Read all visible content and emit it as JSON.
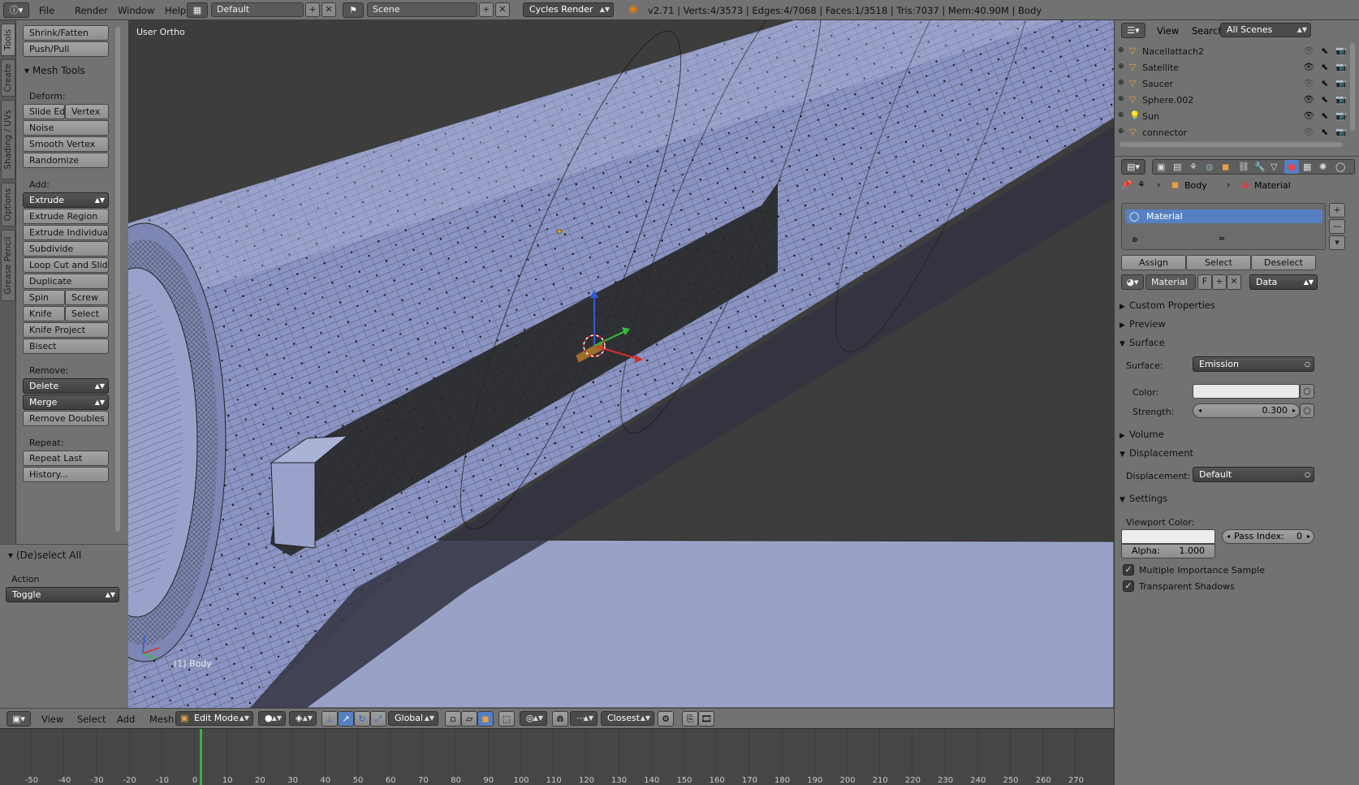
{
  "topbar": {
    "menus": [
      "File",
      "Render",
      "Window",
      "Help"
    ],
    "layout": "Default",
    "scene": "Scene",
    "engine": "Cycles Render",
    "stats": "v2.71 | Verts:4/3573 | Edges:4/7068 | Faces:1/3518 | Tris:7037 | Mem:40.90M | Body"
  },
  "left_tabs": [
    "Tools",
    "Create",
    "Shading / UVs",
    "Options",
    "Grease Pencil"
  ],
  "tools": {
    "top_buttons": [
      "Shrink/Fatten",
      "Push/Pull"
    ],
    "panel_title": "Mesh Tools",
    "deform_label": "Deform:",
    "deform": {
      "slide_edge": "Slide Ed",
      "vertex": "Vertex",
      "noise": "Noise",
      "smooth": "Smooth Vertex",
      "randomize": "Randomize"
    },
    "add_label": "Add:",
    "add": {
      "extrude": "Extrude",
      "extrude_region": "Extrude Region",
      "extrude_individual": "Extrude Individual",
      "subdivide": "Subdivide",
      "loop_cut": "Loop Cut and Slide",
      "duplicate": "Duplicate",
      "spin": "Spin",
      "screw": "Screw",
      "knife": "Knife",
      "select": "Select",
      "knife_project": "Knife Project",
      "bisect": "Bisect"
    },
    "remove_label": "Remove:",
    "remove": {
      "delete": "Delete",
      "merge": "Merge",
      "remove_doubles": "Remove Doubles"
    },
    "repeat_label": "Repeat:",
    "repeat": {
      "repeat_last": "Repeat Last",
      "history": "History..."
    }
  },
  "operator": {
    "title": "(De)select All",
    "action_label": "Action",
    "action_value": "Toggle"
  },
  "viewport": {
    "view_name": "User Ortho",
    "object_label": "(1) Body"
  },
  "view3d_header": {
    "menus": [
      "View",
      "Select",
      "Add",
      "Mesh"
    ],
    "mode": "Edit Mode",
    "orientation": "Global",
    "snap": "Closest"
  },
  "timeline": {
    "ticks": [
      "-50",
      "-40",
      "-30",
      "-20",
      "-10",
      "0",
      "10",
      "20",
      "30",
      "40",
      "50",
      "60",
      "70",
      "80",
      "90",
      "100",
      "110",
      "120",
      "130",
      "140",
      "150",
      "160",
      "170",
      "180",
      "190",
      "200",
      "210",
      "220",
      "230",
      "240",
      "250",
      "260",
      "270"
    ]
  },
  "outliner": {
    "menus": [
      "View",
      "Search"
    ],
    "scene_filter": "All Scenes",
    "items": [
      {
        "name": "Nacellattach2",
        "type": "mesh",
        "visible": false
      },
      {
        "name": "Satellite",
        "type": "mesh",
        "visible": true
      },
      {
        "name": "Saucer",
        "type": "mesh",
        "visible": false
      },
      {
        "name": "Sphere.002",
        "type": "mesh",
        "visible": true
      },
      {
        "name": "Sun",
        "type": "lamp",
        "visible": true
      },
      {
        "name": "connector",
        "type": "mesh",
        "visible": false
      }
    ]
  },
  "properties": {
    "breadcrumb": {
      "object": "Body",
      "material": "Material"
    },
    "slot_name": "Material",
    "assign": "Assign",
    "select": "Select",
    "deselect": "Deselect",
    "material_name": "Material",
    "fake_user": "F",
    "link": "Data",
    "sections": {
      "custom_properties": "Custom Properties",
      "preview": "Preview",
      "surface": "Surface",
      "volume": "Volume",
      "displacement": "Displacement",
      "settings": "Settings"
    },
    "surface_label": "Surface:",
    "surface_value": "Emission",
    "color_label": "Color:",
    "strength_label": "Strength:",
    "strength_value": "0.300",
    "displacement_label": "Displacement:",
    "displacement_value": "Default",
    "viewport_color_label": "Viewport Color:",
    "pass_index_label": "Pass Index:",
    "pass_index_value": "0",
    "alpha_label": "Alpha:",
    "alpha_value": "1.000",
    "mis_label": "Multiple Importance Sample",
    "transparent_shadows_label": "Transparent Shadows"
  },
  "colors": {
    "accent": "#5680c2",
    "mesh": "#9aa3cf",
    "timeline_cursor": "#3eb03e"
  }
}
